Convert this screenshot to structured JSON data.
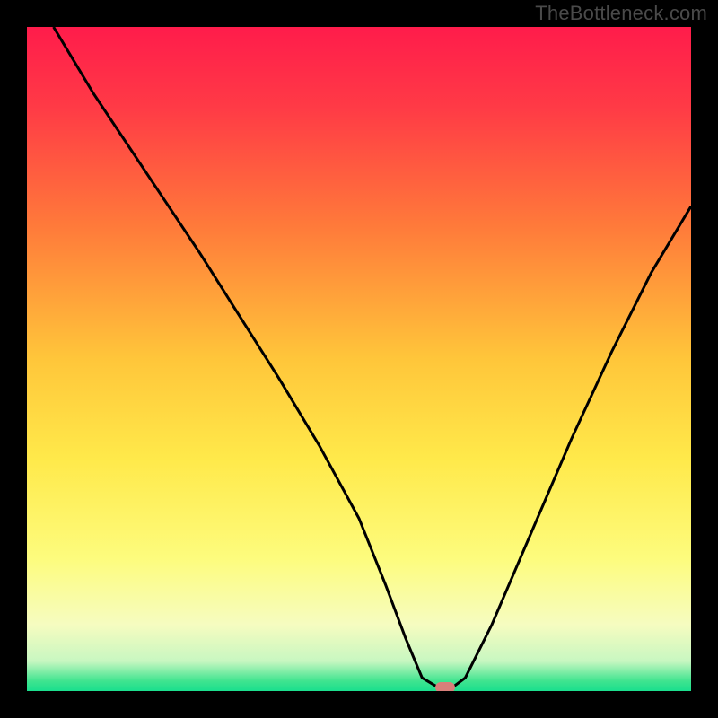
{
  "watermark": "TheBottleneck.com",
  "chart_data": {
    "type": "line",
    "title": "",
    "xlabel": "",
    "ylabel": "",
    "xlim": [
      0,
      100
    ],
    "ylim": [
      0,
      100
    ],
    "background_gradient": {
      "stops": [
        {
          "offset": 0.0,
          "color": "#ff1c4b"
        },
        {
          "offset": 0.12,
          "color": "#ff3a46"
        },
        {
          "offset": 0.3,
          "color": "#ff7a3a"
        },
        {
          "offset": 0.5,
          "color": "#ffc63a"
        },
        {
          "offset": 0.65,
          "color": "#ffe94a"
        },
        {
          "offset": 0.8,
          "color": "#fdfc7d"
        },
        {
          "offset": 0.9,
          "color": "#f6fcc0"
        },
        {
          "offset": 0.955,
          "color": "#c8f7c1"
        },
        {
          "offset": 0.985,
          "color": "#3fe48f"
        },
        {
          "offset": 1.0,
          "color": "#1adf8e"
        }
      ]
    },
    "series": [
      {
        "name": "bottleneck-curve",
        "color": "#000000",
        "stroke_width": 3,
        "x": [
          4,
          10,
          18,
          26,
          32,
          38,
          44,
          50,
          54,
          57,
          59.5,
          62,
          64,
          66,
          70,
          76,
          82,
          88,
          94,
          100
        ],
        "values": [
          100,
          90,
          78,
          66,
          56.5,
          47,
          37,
          26,
          16,
          8,
          2,
          0.5,
          0.5,
          2,
          10,
          24,
          38,
          51,
          63,
          73
        ]
      }
    ],
    "marker": {
      "x": 63,
      "y": 0.5,
      "color": "#d97f7a"
    }
  }
}
